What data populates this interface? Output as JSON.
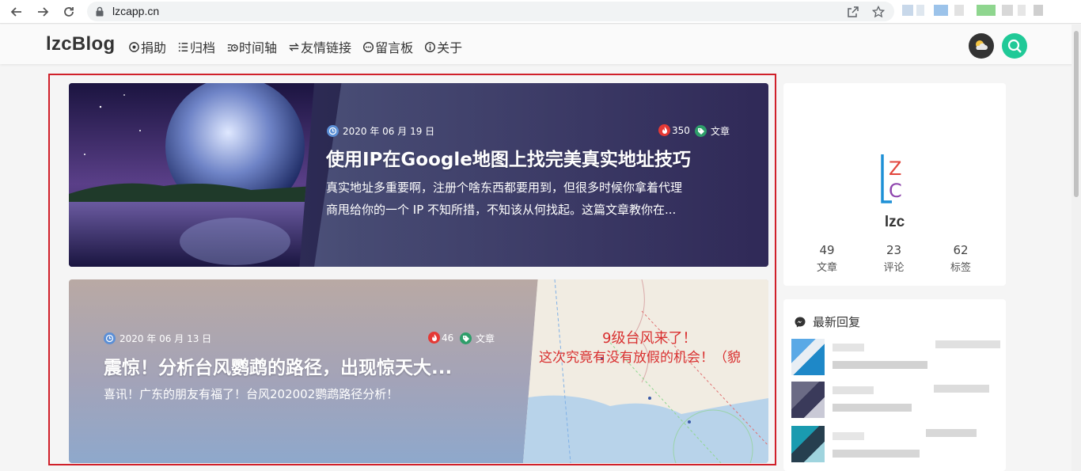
{
  "browser": {
    "url": "lzcapp.cn",
    "back_icon": "arrow-left-icon",
    "forward_icon": "arrow-right-icon",
    "reload_icon": "reload-icon"
  },
  "site": {
    "logo": "lzcBlog",
    "menu": [
      {
        "label": "捐助",
        "icon": "donate-icon"
      },
      {
        "label": "归档",
        "icon": "archive-icon"
      },
      {
        "label": "时间轴",
        "icon": "timeline-icon"
      },
      {
        "label": "友情链接",
        "icon": "links-icon"
      },
      {
        "label": "留言板",
        "icon": "message-icon"
      },
      {
        "label": "关于",
        "icon": "info-icon"
      }
    ]
  },
  "posts": [
    {
      "date": "2020 年 06 月 19 日",
      "views": "350",
      "category": "文章",
      "title": "使用IP在Google地图上找完美真实地址技巧",
      "excerpt_line1": "真实地址多重要啊，注册个啥东西都要用到，但很多时候你拿着代理",
      "excerpt_line2": "商甩给你的一个 IP 不知所措，不知该从何找起。这篇文章教你在..."
    },
    {
      "date": "2020 年 06 月 13 日",
      "views": "46",
      "category": "文章",
      "title": "震惊！分析台风鹦鹉的路径，出现惊天大...",
      "excerpt": "喜讯！广东的朋友有福了！台风202002鹦鹉路径分析！",
      "image_caption": "9级台风来了！",
      "image_caption2": "这次究竟有没有放假的机会！（貌"
    }
  ],
  "profile": {
    "mark_top": "Z",
    "mark_bottom": "C",
    "name": "lzc",
    "stats": [
      {
        "value": "49",
        "label": "文章"
      },
      {
        "value": "23",
        "label": "评论"
      },
      {
        "value": "62",
        "label": "标签"
      }
    ]
  },
  "replies": {
    "title": "最新回复"
  },
  "colors": {
    "accent": "#20c997",
    "frame": "#d0202a",
    "hot": "#e53935",
    "tag": "#2e9e6a",
    "clock": "#5b8fd6"
  }
}
